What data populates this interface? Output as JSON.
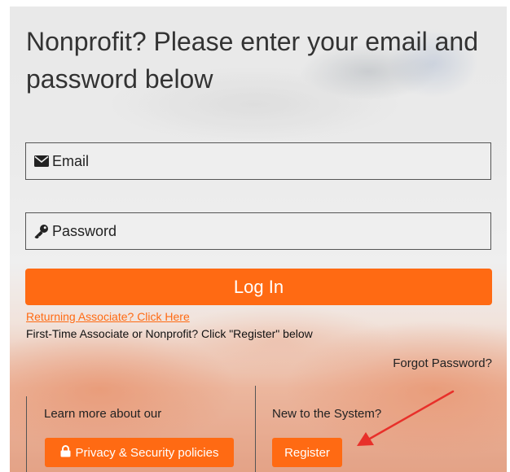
{
  "heading": "Nonprofit? Please enter your email and password below",
  "email_field": {
    "placeholder": "Email",
    "icon": "envelope-icon"
  },
  "password_field": {
    "placeholder": "Password",
    "icon": "key-icon"
  },
  "login_button": "Log In",
  "returning_link": "Returning Associate? Click Here",
  "first_time_text": "First-Time Associate or Nonprofit? Click \"Register\" below",
  "forgot_link": "Forgot Password?",
  "left_column": {
    "text": "Learn more about our",
    "button": "Privacy & Security policies",
    "icon": "lock-icon"
  },
  "right_column": {
    "text": "New to the System?",
    "button": "Register"
  },
  "colors": {
    "accent": "#ff6a13",
    "annotation_arrow": "#e8302a"
  }
}
